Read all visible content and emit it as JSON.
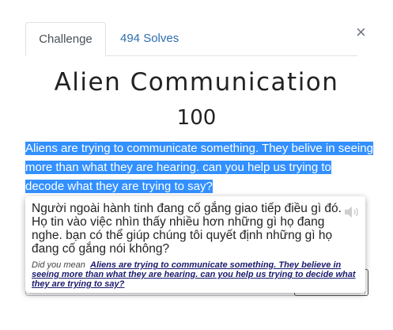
{
  "tabs": [
    {
      "label": "Challenge",
      "active": true
    },
    {
      "label": "494 Solves",
      "active": false
    }
  ],
  "close_symbol": "×",
  "challenge": {
    "name": "Alien Communication",
    "value": "100",
    "description": "Aliens are trying to communicate something. They belive in seeing more than what they are hearing. can you help us trying to decode what they are trying to say?"
  },
  "translate_popup": {
    "translation": "Người ngoài hành tinh đang cố gắng giao tiếp điều gì đó. Họ tin vào việc nhìn thấy nhiều hơn những gì họ đang nghe. bạn có thể giúp chúng tôi quyết định những gì họ đang cố gắng nói không?",
    "did_you_mean_label": "Did you mean",
    "suggestion": "Aliens are trying to communicate something. They believe in seeing more than what they are hearing. can you help us trying to decide what they are trying to say?",
    "speaker_icon": "speaker-icon"
  },
  "colors": {
    "selection": "#3390ff",
    "link": "#2f6fb0",
    "suggestion": "#1a1a6e"
  }
}
